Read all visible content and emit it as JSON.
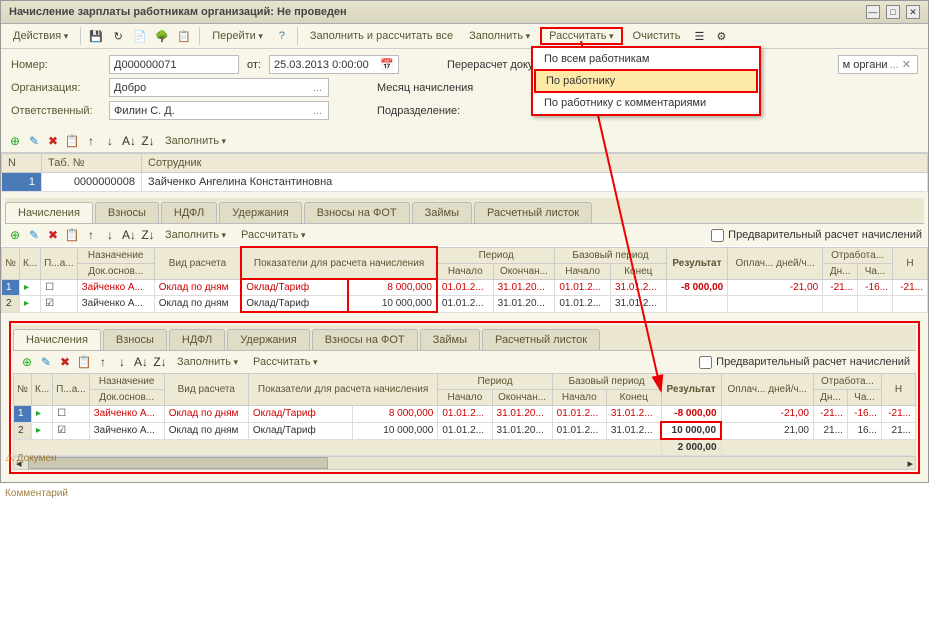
{
  "window": {
    "title": "Начисление зарплаты работникам организаций: Не проведен"
  },
  "toolbar": {
    "actions": "Действия",
    "go": "Перейти",
    "fill_calc_all": "Заполнить и рассчитать все",
    "fill": "Заполнить",
    "calc": "Рассчитать",
    "clear": "Очистить"
  },
  "dropdown": {
    "all_workers": "По всем работникам",
    "by_worker": "По работнику",
    "by_worker_comments": "По работнику с комментариями"
  },
  "form": {
    "num_label": "Номер:",
    "num": "Д000000071",
    "from_label": "от:",
    "date": "25.03.2013 0:00:00",
    "org_label": "Организация:",
    "org": "Добро",
    "resp_label": "Ответственный:",
    "resp": "Филин С. Д.",
    "recalc_label": "Перерасчет докумен",
    "recalc_val": "м органи",
    "month_label": "Месяц начисления",
    "dept_label": "Подразделение:",
    "dept": ""
  },
  "emp_toolbar": {
    "fill": "Заполнить"
  },
  "emp_table": {
    "headers": {
      "n": "N",
      "tab": "Таб. №",
      "emp": "Сотрудник"
    },
    "rows": [
      {
        "n": "1",
        "tab": "0000000008",
        "emp": "Зайченко Ангелина Константиновна"
      }
    ]
  },
  "tabs": [
    "Начисления",
    "Взносы",
    "НДФЛ",
    "Удержания",
    "Взносы на ФОТ",
    "Займы",
    "Расчетный листок"
  ],
  "subtb": {
    "fill": "Заполнить",
    "calc": "Рассчитать",
    "preview": "Предварительный расчет начислений"
  },
  "grid": {
    "headers": {
      "n": "№",
      "k": "К...",
      "p": "П...а...",
      "assign": "Назначение",
      "doc": "Док.основ...",
      "type": "Вид расчета",
      "indicators": "Показатели для расчета начисления",
      "period": "Период",
      "start": "Начало",
      "end": "Окончан...",
      "base": "Базовый период",
      "bstart": "Начало",
      "bend": "Конец",
      "result": "Результат",
      "paid": "Оплач...\nдней/ч...",
      "worked": "Отработа...",
      "dn": "Дн...",
      "ch": "Ча...",
      "dn2": "Дн...",
      "h": "Н"
    },
    "rows1": [
      {
        "n": "1",
        "chk": "",
        "emp": "Зайченко А...",
        "type": "Оклад по дням",
        "ind": "Оклад/Тариф",
        "val": "8 000,000",
        "s": "01.01.2...",
        "e": "31.01.20...",
        "bs": "01.01.2...",
        "be": "31.01.2...",
        "res": "-8 000,00",
        "paid": "-21,00",
        "d1": "-21...",
        "d2": "-16...",
        "d3": "-21...",
        "red": true
      },
      {
        "n": "2",
        "chk": "✓",
        "emp": "Зайченко А...",
        "type": "Оклад по дням",
        "ind": "Оклад/Тариф",
        "val": "10 000,000",
        "s": "01.01.2...",
        "e": "31.01.20...",
        "bs": "01.01.2...",
        "be": "31.01.2...",
        "res": "",
        "paid": "",
        "d1": "",
        "d2": "",
        "d3": "",
        "red": false
      }
    ],
    "rows2": [
      {
        "n": "1",
        "chk": "",
        "emp": "Зайченко А...",
        "type": "Оклад по дням",
        "ind": "Оклад/Тариф",
        "val": "8 000,000",
        "s": "01.01.2...",
        "e": "31.01.20...",
        "bs": "01.01.2...",
        "be": "31.01.2...",
        "res": "-8 000,00",
        "paid": "-21,00",
        "d1": "-21...",
        "d2": "-16...",
        "d3": "-21...",
        "red": true
      },
      {
        "n": "2",
        "chk": "✓",
        "emp": "Зайченко А...",
        "type": "Оклад по дням",
        "ind": "Оклад/Тариф",
        "val": "10 000,000",
        "s": "01.01.2...",
        "e": "31.01.20...",
        "bs": "01.01.2...",
        "be": "31.01.2...",
        "res": "10 000,00",
        "paid": "21,00",
        "d1": "21...",
        "d2": "16...",
        "d3": "21...",
        "red": false
      }
    ],
    "footer": "2 000,00"
  },
  "sidebar": {
    "doc": "Докумен",
    "comment": "Комментарий"
  }
}
